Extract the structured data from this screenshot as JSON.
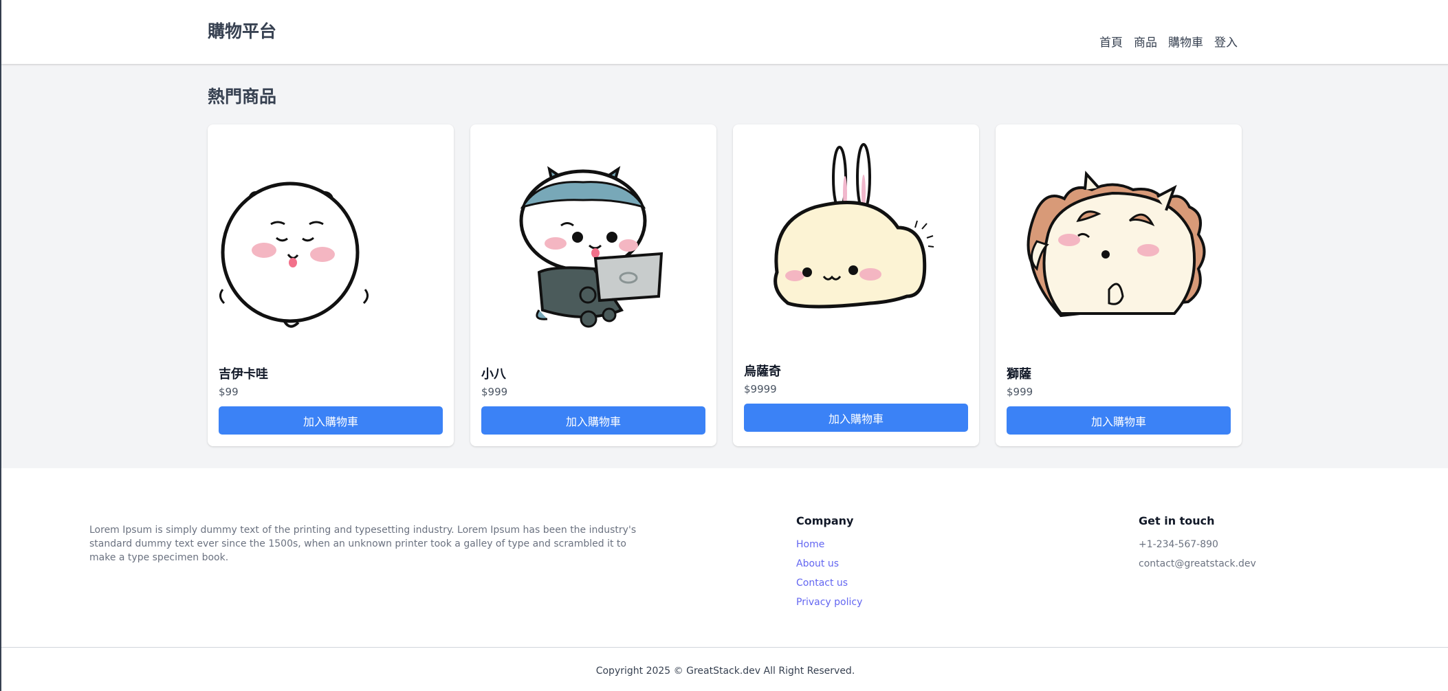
{
  "header": {
    "logo": "購物平台",
    "nav": [
      "首頁",
      "商品",
      "購物車",
      "登入"
    ]
  },
  "main": {
    "section_title": "熱門商品",
    "products": [
      {
        "name": "吉伊卡哇",
        "price": "$99",
        "button": "加入購物車",
        "image_icon": "white-bear-character"
      },
      {
        "name": "小八",
        "price": "$999",
        "button": "加入購物車",
        "image_icon": "cat-with-laptop-character"
      },
      {
        "name": "烏薩奇",
        "price": "$9999",
        "button": "加入購物車",
        "image_icon": "rabbit-character"
      },
      {
        "name": "獅薩",
        "price": "$999",
        "button": "加入購物車",
        "image_icon": "lion-character"
      }
    ]
  },
  "footer": {
    "description": "Lorem Ipsum is simply dummy text of the printing and typesetting industry. Lorem Ipsum has been the industry's standard dummy text ever since the 1500s, when an unknown printer took a galley of type and scrambled it to make a type specimen book.",
    "company_heading": "Company",
    "company_links": [
      "Home",
      "About us",
      "Contact us",
      "Privacy policy"
    ],
    "contact_heading": "Get in touch",
    "phone": "+1-234-567-890",
    "email": "contact@greatstack.dev",
    "copyright": "Copyright 2025 © GreatStack.dev All Right Reserved."
  },
  "colors": {
    "button": "#3b82f6",
    "link": "#6366f1",
    "main_bg": "#f3f4f6"
  }
}
